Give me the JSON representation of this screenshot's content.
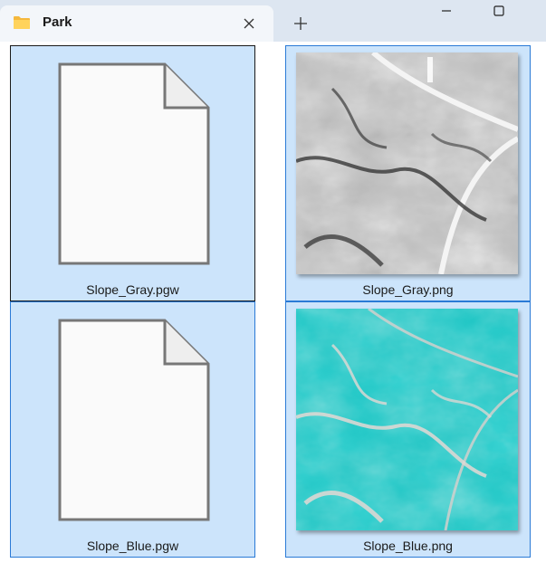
{
  "window": {
    "tab_title": "Park",
    "icons": {
      "folder": "folder-icon",
      "close": "close-icon",
      "new_tab": "plus-icon",
      "minimize": "minimize-icon",
      "maximize": "maximize-icon"
    }
  },
  "files": [
    {
      "name": "Slope_Gray.pgw",
      "kind": "generic-document"
    },
    {
      "name": "Slope_Gray.png",
      "kind": "grayscale-slope-image"
    },
    {
      "name": "Slope_Blue.pgw",
      "kind": "generic-document"
    },
    {
      "name": "Slope_Blue.png",
      "kind": "cyan-slope-image"
    }
  ],
  "colors": {
    "titlebar": "#dde6f1",
    "tab": "#f3f6fa",
    "selection_fill": "#cce4fb",
    "selection_border": "#2a7ad6",
    "blue_image_base": "#1fc5c4"
  }
}
